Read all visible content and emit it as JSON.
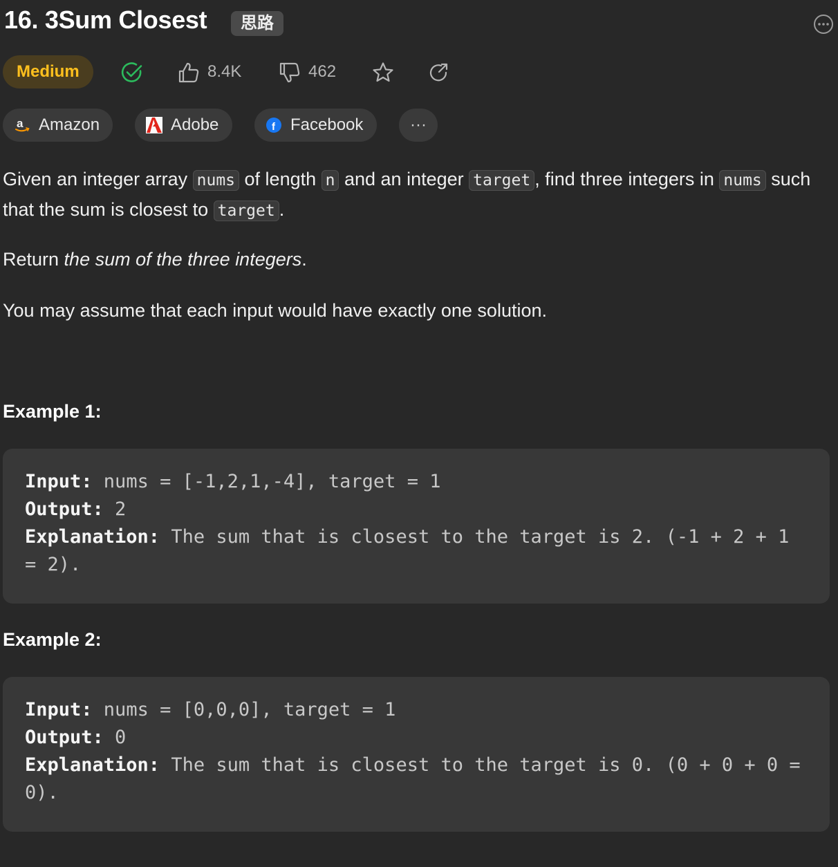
{
  "problem": {
    "title": "16. 3Sum Closest",
    "cn_tag": "思路",
    "difficulty": "Medium",
    "likes": "8.4K",
    "dislikes": "462"
  },
  "companies": [
    {
      "name": "Amazon"
    },
    {
      "name": "Adobe"
    },
    {
      "name": "Facebook"
    }
  ],
  "more_label": "···",
  "description": {
    "p1": {
      "t1": "Given an integer array ",
      "c1": "nums",
      "t2": " of length ",
      "c2": "n",
      "t3": " and an integer ",
      "c3": "target",
      "t4": ", find three integers in ",
      "c4": "nums",
      "t5": " such that the sum is closest to ",
      "c5": "target",
      "t6": "."
    },
    "p2": {
      "t1": "Return ",
      "em": "the sum of the three integers",
      "t2": "."
    },
    "p3": "You may assume that each input would have exactly one solution."
  },
  "examples": [
    {
      "title": "Example 1:",
      "input_label": "Input:",
      "input": " nums = [-1,2,1,-4], target = 1",
      "output_label": "Output:",
      "output": " 2",
      "explanation_label": "Explanation:",
      "explanation": " The sum that is closest to the target is 2. (-1 + 2 + 1 = 2)."
    },
    {
      "title": "Example 2:",
      "input_label": "Input:",
      "input": " nums = [0,0,0], target = 1",
      "output_label": "Output:",
      "output": " 0",
      "explanation_label": "Explanation:",
      "explanation": " The sum that is closest to the target is 0. (0 + 0 + 0 = 0)."
    }
  ],
  "colors": {
    "background": "#282828",
    "medium": "#ffc01e",
    "solved": "#2cbb5d"
  },
  "icons": [
    "solved-check-icon",
    "thumbs-up-icon",
    "thumbs-down-icon",
    "star-icon",
    "share-icon",
    "more-options-icon"
  ]
}
